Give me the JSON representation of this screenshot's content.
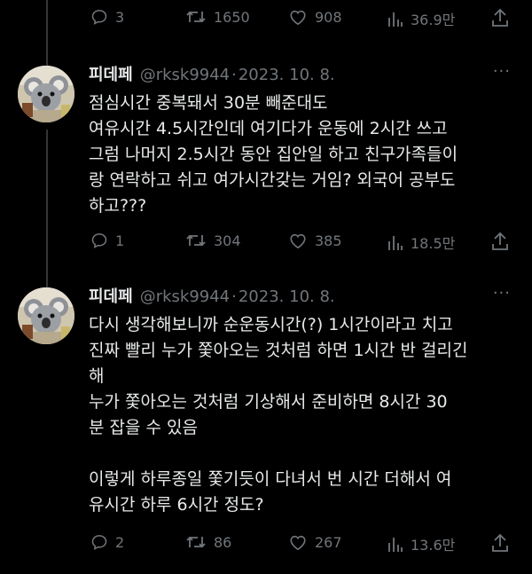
{
  "top_actions": {
    "replies": "3",
    "retweets": "1650",
    "likes": "908",
    "views": "36.9만"
  },
  "tweets": [
    {
      "name": "피데페",
      "handle": "@rksk9944",
      "sep": "·",
      "date": "2023. 10. 8.",
      "more": "···",
      "text": "점심시간 중복돼서 30분 빼준대도\n여유시간 4.5시간인데 여기다가 운동에 2시간 쓰고\n그럼 나머지 2.5시간 동안 집안일 하고 친구가족들이\n랑 연락하고 쉬고 여가시간갖는 거임? 외국어 공부도\n하고???",
      "replies": "1",
      "retweets": "304",
      "likes": "385",
      "views": "18.5만"
    },
    {
      "name": "피데페",
      "handle": "@rksk9944",
      "sep": "·",
      "date": "2023. 10. 8.",
      "more": "···",
      "text": "다시 생각해보니까 순운동시간(?) 1시간이라고 치고\n진짜 빨리 누가 쫓아오는 것처럼 하면 1시간 반 걸리긴\n해\n누가 쫓아오는 것처럼 기상해서 준비하면 8시간 30\n분 잡을 수 있음\n\n이렇게 하루종일 쫓기듯이 다녀서 번 시간 더해서 여\n유시간 하루 6시간 정도?",
      "replies": "2",
      "retweets": "86",
      "likes": "267",
      "views": "13.6만"
    }
  ],
  "icons": {
    "reply": "reply-icon",
    "retweet": "retweet-icon",
    "like": "heart-icon",
    "views": "views-icon",
    "share": "share-icon"
  },
  "colors": {
    "background": "#000000",
    "text": "#e7e9ea",
    "muted": "#71767b",
    "thread_line": "#333639"
  }
}
